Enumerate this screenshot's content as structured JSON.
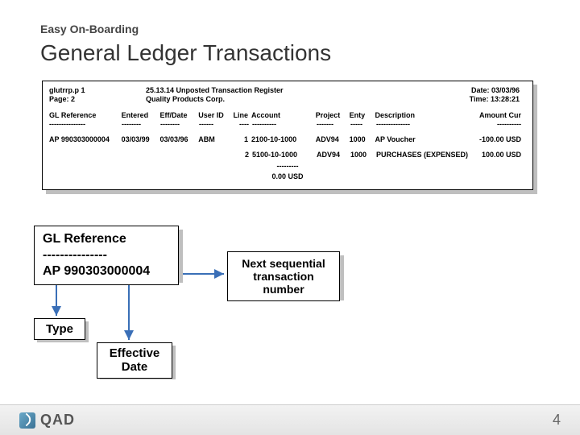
{
  "kicker": "Easy On-Boarding",
  "title": "General Ledger Transactions",
  "report": {
    "header": {
      "prog": "glutrrp.p 1",
      "page": "Page: 2",
      "report_title": "25.13.14 Unposted Transaction Register",
      "company": "Quality Products Corp.",
      "date": "Date: 03/03/96",
      "time": "Time: 13:28:21"
    },
    "columns": {
      "ref": "GL Reference",
      "entered": "Entered",
      "eff": "Eff/Date",
      "uid": "User ID",
      "line": "Line",
      "acct": "Account",
      "proj": "Project",
      "enty": "Enty",
      "desc": "Description",
      "amt": "Amount Cur"
    },
    "dashes": {
      "ref": "---------------",
      "entered": "--------",
      "eff": "--------",
      "uid": "------",
      "line": "----",
      "acct": "----------",
      "proj": "-------",
      "enty": "-----",
      "desc": "--------------",
      "amt": "----------"
    },
    "rows": [
      {
        "ref": "AP 990303000004",
        "entered": "03/03/99",
        "eff": "03/03/96",
        "uid": "ABM",
        "line": "1",
        "acct": "2100-10-1000",
        "proj": "ADV94",
        "enty": "1000",
        "desc": "AP Voucher",
        "amt": "-100.00 USD"
      },
      {
        "ref": "",
        "entered": "",
        "eff": "",
        "uid": "",
        "line": "2",
        "acct": "5100-10-1000",
        "proj": "ADV94",
        "enty": "1000",
        "desc": "PURCHASES (EXPENSED)",
        "amt": "100.00 USD"
      }
    ],
    "total_dash": "---------",
    "total": "0.00 USD"
  },
  "callouts": {
    "glref_h": "GL Reference",
    "glref_d": "---------------",
    "glref_v": "AP 990303000004",
    "next": "Next sequential transaction number",
    "type": "Type",
    "eff": "Effective Date"
  },
  "footer": {
    "brand": "QAD",
    "page": "4"
  }
}
